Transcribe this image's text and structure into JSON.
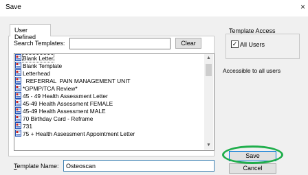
{
  "window": {
    "title": "Save",
    "close_glyph": "×"
  },
  "tabs": [
    {
      "label": "User Defined",
      "active": true
    }
  ],
  "search": {
    "label": "Search Templates:",
    "value": "",
    "placeholder": "",
    "clear_label": "Clear"
  },
  "templates": {
    "items": [
      {
        "label": "Blank Letter",
        "icon": "letter-icon",
        "selected": true
      },
      {
        "label": "Blank Template",
        "icon": "template-icon",
        "selected": false
      },
      {
        "label": "Letterhead",
        "icon": "template-icon",
        "selected": false
      },
      {
        "label": "  REFERRAL  PAIN MANAGEMENT UNIT",
        "icon": "template-icon",
        "selected": false
      },
      {
        "label": "*GPMP/TCA Review*",
        "icon": "template-icon",
        "selected": false
      },
      {
        "label": "45 - 49 Health Assessment Letter",
        "icon": "template-icon",
        "selected": false
      },
      {
        "label": "45-49 Health Assessment FEMALE",
        "icon": "template-icon",
        "selected": false
      },
      {
        "label": "45-49 Health Assessment MALE",
        "icon": "template-icon",
        "selected": false
      },
      {
        "label": "70 Birthday Card - Reframe",
        "icon": "template-icon",
        "selected": false
      },
      {
        "label": "731",
        "icon": "template-icon",
        "selected": false
      },
      {
        "label": "75 + Health Assessment Appointment Letter",
        "icon": "template-icon",
        "selected": false
      }
    ]
  },
  "template_name": {
    "label_prefix": "",
    "label_underlined": "T",
    "label_rest": "emplate Name:",
    "value": "Osteoscan"
  },
  "access": {
    "title": "Template Access",
    "all_users_label": "All Users",
    "all_users_checked": true,
    "check_glyph": "✓",
    "note": "Accessible to all users"
  },
  "buttons": {
    "save": "Save",
    "cancel": "Cancel"
  },
  "scrollbar": {
    "up_glyph": "▲",
    "down_glyph": "▼"
  },
  "colors": {
    "highlight_ring": "#1fae4b",
    "focus_border": "#0078d7",
    "icon_red": "#c62828",
    "icon_blue": "#1e4fb3"
  }
}
